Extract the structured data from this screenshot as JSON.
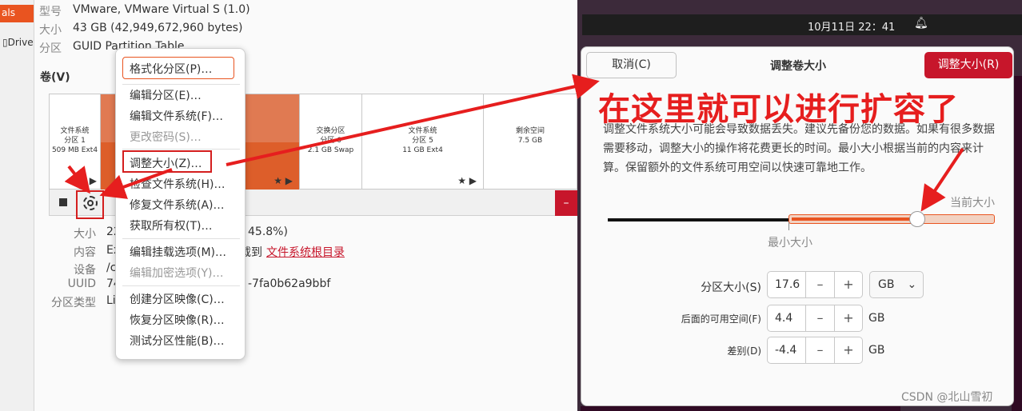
{
  "sidebar": {
    "tab": "als",
    "drive": "Drive"
  },
  "info": {
    "model_label": "型号",
    "model_value": "VMware, VMware Virtual S (1.0)",
    "size_label": "大小",
    "size_value": "43 GB (42,949,672,960 bytes)",
    "partition_label": "分区",
    "partition_value": "GUID Partition Table"
  },
  "volumes": {
    "title": "卷(V)",
    "segments": [
      {
        "l1": "文件系统",
        "l2": "分区 1",
        "l3": "509 MB Ext4"
      },
      {
        "l1": "",
        "l2": "",
        "l3": ""
      },
      {
        "l1": "交换分区",
        "l2": "分区 6",
        "l3": "2.1 GB Swap"
      },
      {
        "l1": "文件系统",
        "l2": "分区 5",
        "l3": "11 GB Ext4"
      },
      {
        "l1": "剩余空间",
        "l2": "7.5 GB",
        "l3": ""
      }
    ],
    "minus": "–"
  },
  "details": {
    "size_label": "大小",
    "size_value": "22",
    "size_tail": "45.8%)",
    "content_label": "内容",
    "content_value": "Ex",
    "content_tail": "载到",
    "content_link": "文件系统根目录",
    "device_label": "设备",
    "device_value": "/c",
    "uuid_label": "UUID",
    "uuid_value": "74",
    "uuid_tail": "-7fa0b62a9bbf",
    "ptype_label": "分区类型",
    "ptype_value": "Li"
  },
  "menu": {
    "items": [
      "格式化分区(P)…",
      "编辑分区(E)…",
      "编辑文件系统(F)…",
      "更改密码(S)…",
      "调整大小(Z)…",
      "检查文件系统(H)…",
      "修复文件系统(A)…",
      "获取所有权(T)…",
      "编辑挂载选项(M)…",
      "编辑加密选项(Y)…",
      "创建分区映像(C)…",
      "恢复分区映像(R)…",
      "测试分区性能(B)…"
    ]
  },
  "topbar": {
    "clock": "10月11日  22：41"
  },
  "dialog": {
    "cancel": "取消(C)",
    "title": "调整卷大小",
    "confirm": "调整大小(R)",
    "warning": "调整文件系统大小可能会导致数据丢失。建议先备份您的数据。如果有很多数据需要移动，调整大小的操作将花费更长的时间。最小大小根据当前的内容来计算。保留额外的文件系统可用空间以快速可靠地工作。",
    "slider_current": "当前大小",
    "slider_min": "最小大小",
    "slider_level": 0.62,
    "rows": [
      {
        "label": "分区大小(S)",
        "value": "17.6",
        "unit": "GB"
      },
      {
        "label": "后面的可用空间(F)",
        "value": "4.4",
        "unit": "GB"
      },
      {
        "label": "差别(D)",
        "value": "-4.4",
        "unit": "GB"
      }
    ],
    "minus": "–",
    "plus": "+"
  },
  "annotation": {
    "text": "在这里就可以进行扩容了"
  },
  "watermark": "CSDN @北山雪初"
}
